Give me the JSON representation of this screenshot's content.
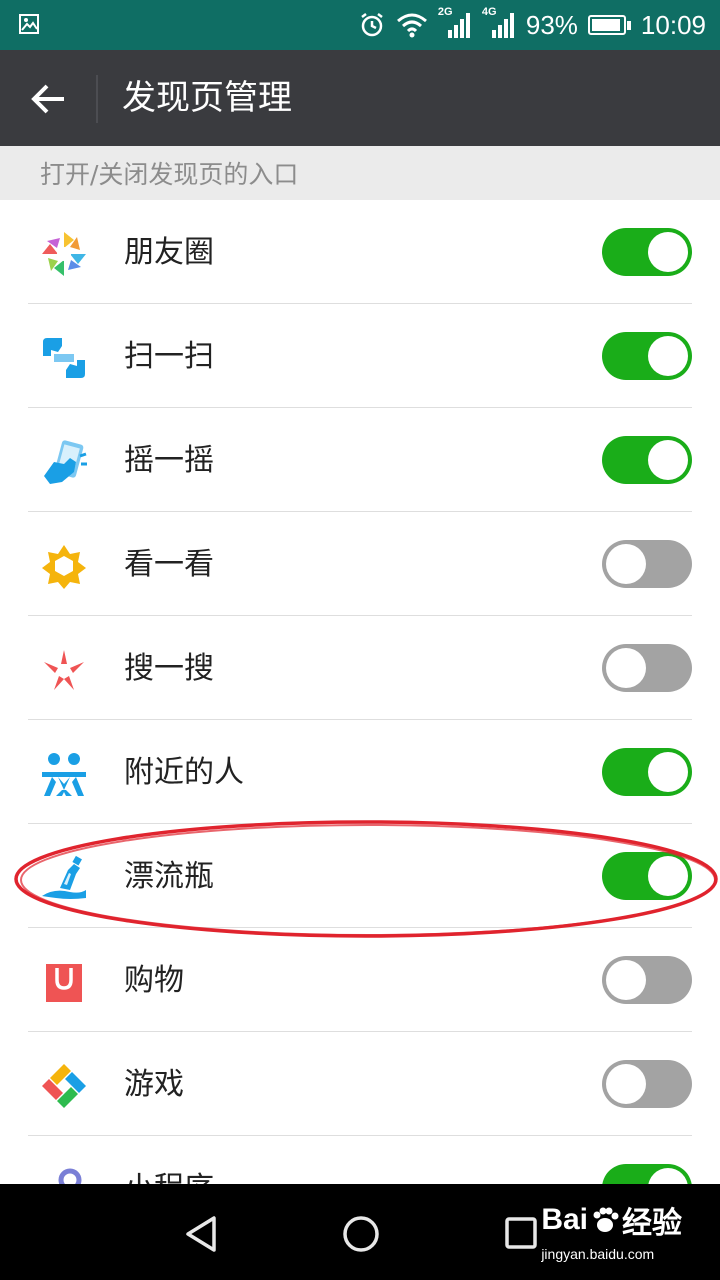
{
  "status_bar": {
    "net_tag_1": "2G",
    "net_tag_2": "4G",
    "battery_percent": "93%",
    "battery_level": 0.93,
    "time": "10:09",
    "icons": [
      "image-icon",
      "alarm-icon",
      "wifi-icon",
      "signal-icon",
      "battery-icon"
    ]
  },
  "header": {
    "back_icon": "arrow-left-icon",
    "title": "发现页管理"
  },
  "section": {
    "title": "打开/关闭发现页的入口"
  },
  "items": [
    {
      "label": "朋友圈",
      "icon": "moments-icon",
      "enabled": true
    },
    {
      "label": "扫一扫",
      "icon": "scan-icon",
      "enabled": true
    },
    {
      "label": "摇一摇",
      "icon": "shake-icon",
      "enabled": true
    },
    {
      "label": "看一看",
      "icon": "top-stories-icon",
      "enabled": false
    },
    {
      "label": "搜一搜",
      "icon": "search-icon",
      "enabled": false
    },
    {
      "label": "附近的人",
      "icon": "people-nearby-icon",
      "enabled": true
    },
    {
      "label": "漂流瓶",
      "icon": "drift-bottle-icon",
      "enabled": true
    },
    {
      "label": "购物",
      "icon": "shopping-bag-icon",
      "enabled": false
    },
    {
      "label": "游戏",
      "icon": "games-icon",
      "enabled": false
    },
    {
      "label": "小程序",
      "icon": "mini-program-icon",
      "enabled": true
    }
  ],
  "annotation": {
    "highlighted_item": "漂流瓶",
    "color": "#e0242e"
  },
  "colors": {
    "toggle_on": "#1aad19",
    "toggle_off": "#a3a3a3",
    "status_bar": "#0f6e64",
    "title_bar": "#3a3b3f"
  },
  "nav_bar": {
    "icons": [
      "back-triangle-icon",
      "home-circle-icon",
      "recents-square-icon"
    ],
    "watermark": {
      "brand_left": "Bai",
      "brand_right": "经验",
      "url": "jingyan.baidu.com"
    }
  }
}
